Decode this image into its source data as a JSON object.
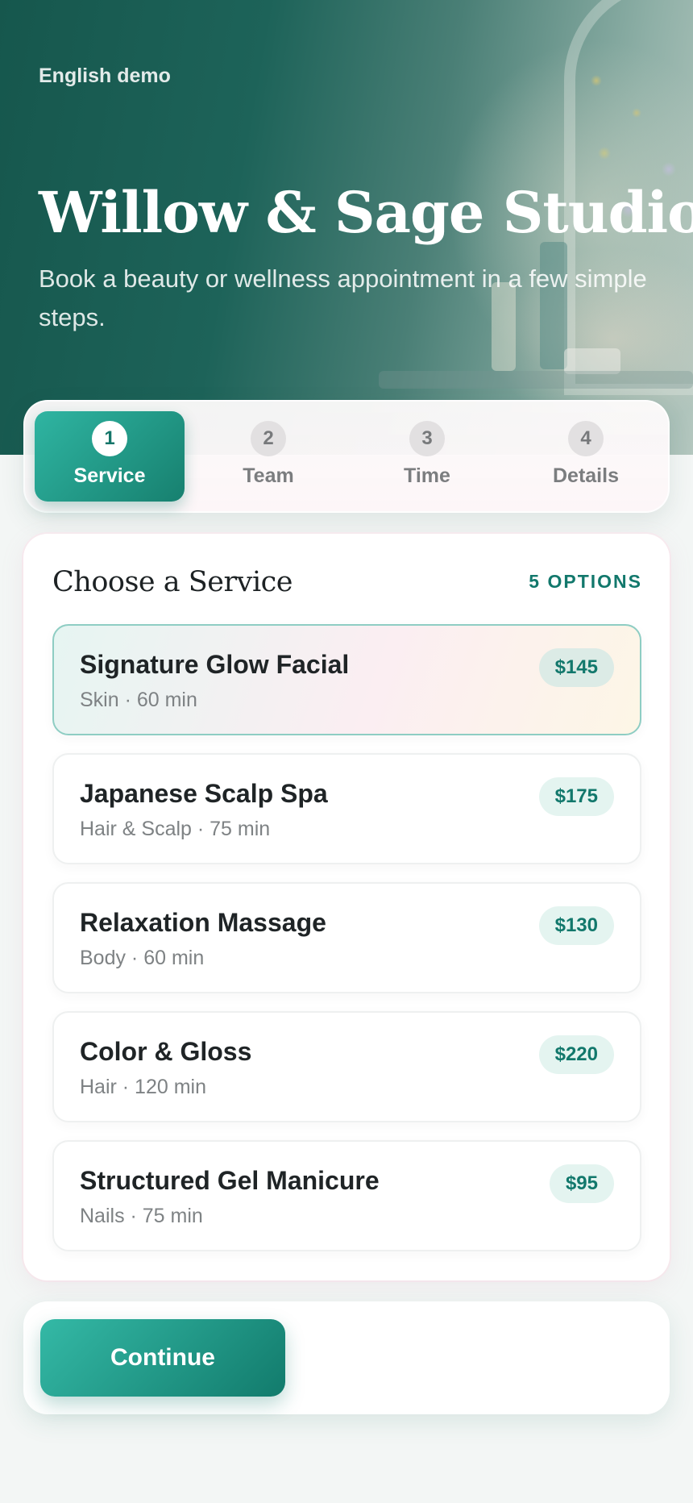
{
  "app": {
    "demo_label": "English demo",
    "title": "Willow & Sage Studio",
    "subtitle": "Book a beauty or wellness appointment in a few simple steps."
  },
  "steps": [
    {
      "number": "1",
      "label": "Service",
      "active": true
    },
    {
      "number": "2",
      "label": "Team",
      "active": false
    },
    {
      "number": "3",
      "label": "Time",
      "active": false
    },
    {
      "number": "4",
      "label": "Details",
      "active": false
    }
  ],
  "services_panel": {
    "title": "Choose a Service",
    "options_count": "5 OPTIONS",
    "items": [
      {
        "name": "Signature Glow Facial",
        "meta": "Skin · 60 min",
        "price": "$145",
        "selected": true
      },
      {
        "name": "Japanese Scalp Spa",
        "meta": "Hair & Scalp · 75 min",
        "price": "$175",
        "selected": false
      },
      {
        "name": "Relaxation Massage",
        "meta": "Body · 60 min",
        "price": "$130",
        "selected": false
      },
      {
        "name": "Color & Gloss",
        "meta": "Hair · 120 min",
        "price": "$220",
        "selected": false
      },
      {
        "name": "Structured Gel Manicure",
        "meta": "Nails · 75 min",
        "price": "$95",
        "selected": false
      }
    ]
  },
  "footer": {
    "continue_label": "Continue"
  },
  "colors": {
    "accent": "#17806f",
    "accent_light": "#2fb5a2",
    "hero_dark": "#16574d"
  }
}
